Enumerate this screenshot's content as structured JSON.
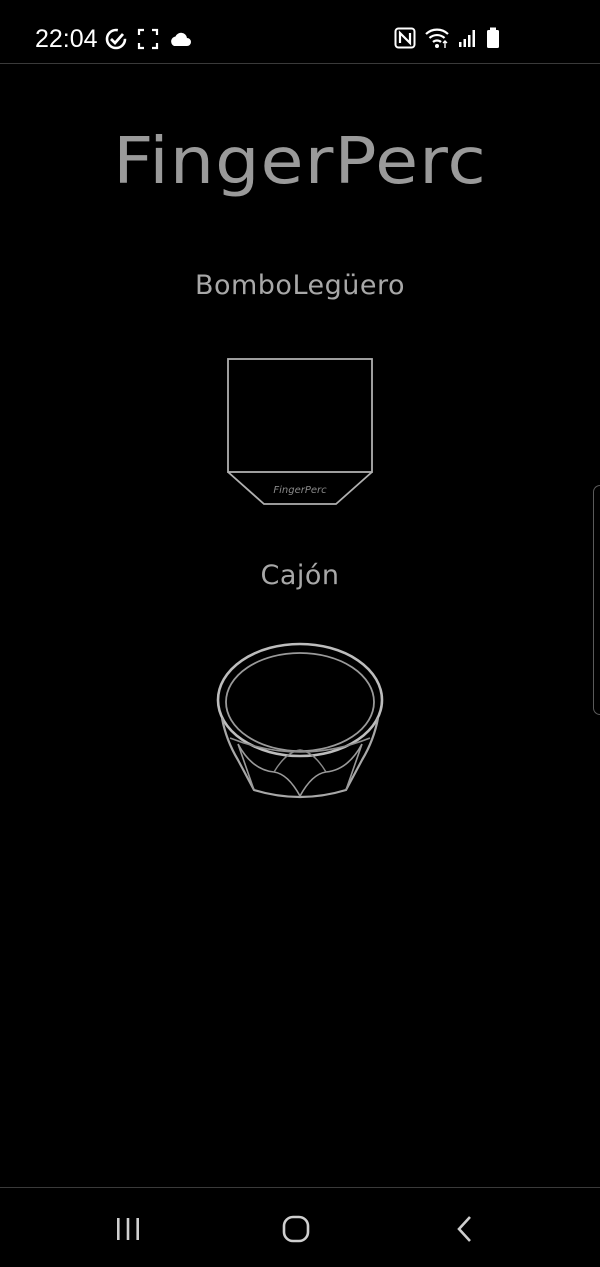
{
  "status_bar": {
    "time": "22:04",
    "left_icons": [
      "check-circle-icon",
      "screenshot-frame-icon",
      "cloud-icon"
    ],
    "right_icons": [
      "nfc-icon",
      "wifi-icon",
      "signal-icon",
      "battery-icon"
    ]
  },
  "app": {
    "title": "FingerPerc",
    "instruments": [
      {
        "label": "BomboLegüero",
        "art_caption": "FingerPerc",
        "icon": "cajon-drum-icon"
      },
      {
        "label": "Cajón",
        "icon": "bombo-drum-icon"
      }
    ]
  },
  "nav_bar": {
    "buttons": [
      "recents-icon",
      "home-icon",
      "back-icon"
    ]
  },
  "colors": {
    "background": "#000000",
    "title": "#9a9a9a",
    "label": "#a8a8a8",
    "line_art": "#b0b0b0"
  }
}
